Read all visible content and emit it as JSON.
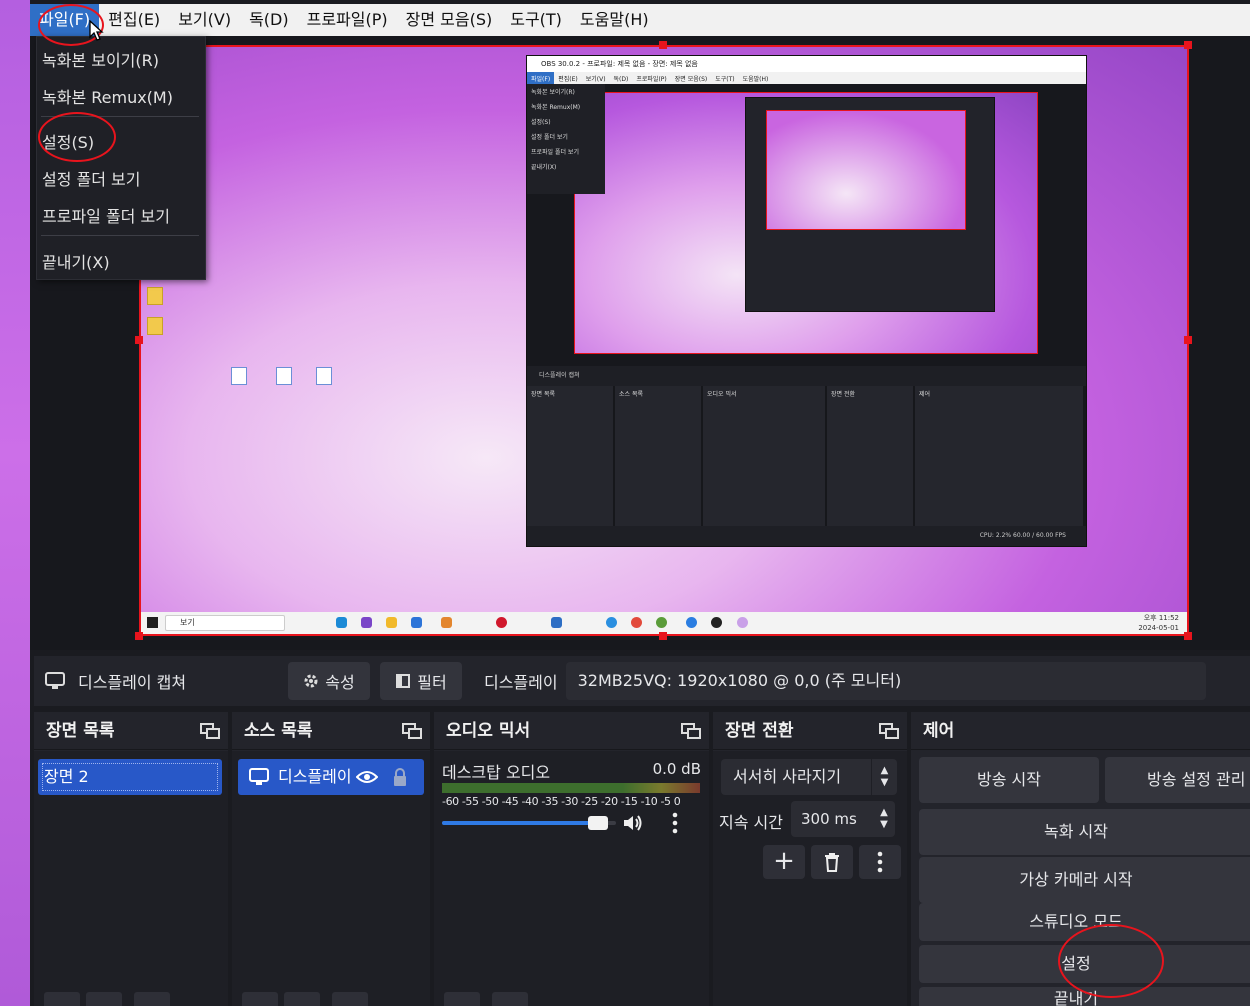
{
  "menubar": {
    "items": [
      "파일(F)",
      "편집(E)",
      "보기(V)",
      "독(D)",
      "프로파일(P)",
      "장면 모음(S)",
      "도구(T)",
      "도움말(H)"
    ]
  },
  "file_menu": {
    "items": [
      "녹화본 보이기(R)",
      "녹화본 Remux(M)",
      "설정(S)",
      "설정 폴더 보기",
      "프로파일 폴더 보기",
      "끝내기(X)"
    ]
  },
  "desktop": {
    "taskbar_search": "보기",
    "clock_time": "오후 11:52",
    "clock_date": "2024-05-01"
  },
  "nested": {
    "title": "OBS 30.0.2 - 프로파일: 제목 없음 - 장면: 제목 없음",
    "menu": [
      "파일(F)",
      "편집(E)",
      "보기(V)",
      "독(D)",
      "프로파일(P)",
      "장면 모음(S)",
      "도구(T)",
      "도움말(H)"
    ],
    "file_items": [
      "녹화본 보이기(R)",
      "녹화본 Remux(M)",
      "설정(S)",
      "설정 폴더 보기",
      "프로파일 폴더 보기",
      "끝내기(X)"
    ],
    "source_bar": "디스플레이 캡쳐",
    "docks": [
      "장면 목록",
      "소스 목록",
      "오디오 믹서",
      "장면 전환",
      "제어"
    ],
    "status": "CPU: 2.2%   60.00 / 60.00 FPS"
  },
  "source_bar": {
    "source_name": "디스플레이 캡쳐",
    "properties_label": "속성",
    "filters_label": "필터",
    "display_label": "디스플레이",
    "display_value": "32MB25VQ: 1920x1080 @ 0,0 (주 모니터)"
  },
  "scenes": {
    "title": "장면 목록",
    "items": [
      "장면 2"
    ]
  },
  "sources": {
    "title": "소스 목록",
    "items": [
      "디스플레이"
    ]
  },
  "mixer": {
    "title": "오디오 믹서",
    "channel": "데스크탑 오디오",
    "level": "0.0 dB",
    "scale": "-60 -55 -50 -45 -40 -35 -30 -25 -20 -15 -10 -5 0",
    "volume": 0.92
  },
  "transitions": {
    "title": "장면 전환",
    "selected": "서서히 사라지기",
    "duration_label": "지속 시간",
    "duration_value": "300 ms"
  },
  "controls": {
    "title": "제어",
    "start_streaming": "방송 시작",
    "stream_settings": "방송 설정 관리",
    "start_recording": "녹화 시작",
    "virtual_camera": "가상 카메라 시작",
    "studio_mode": "스튜디오 모드",
    "settings": "설정",
    "exit": "끝내기"
  },
  "colors": {
    "accent": "#2858c8",
    "annotation": "#e8141d"
  }
}
